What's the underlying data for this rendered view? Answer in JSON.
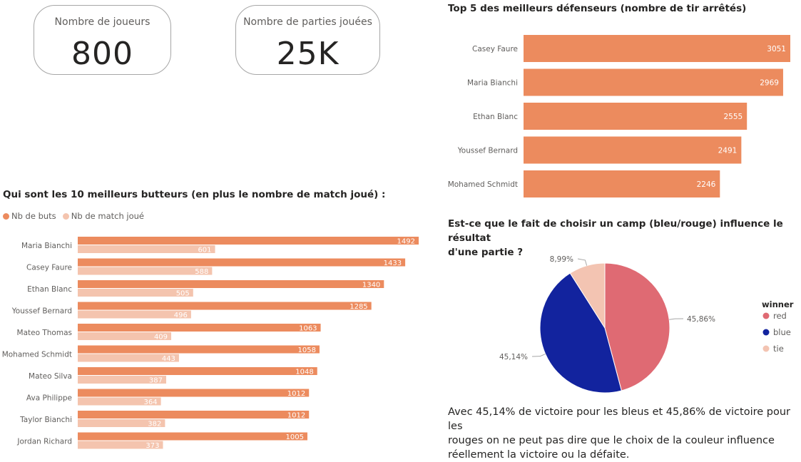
{
  "kpis": [
    {
      "label": "Nombre de joueurs",
      "value": "800"
    },
    {
      "label": "Nombre de parties jouées",
      "value": "25K"
    }
  ],
  "colors": {
    "orange": "#ec8b5e",
    "light_orange": "#f4c4ae",
    "red": "#df6a73",
    "blue": "#12239e",
    "tie": "#f3c4b2"
  },
  "top_defenders": {
    "title": "Top 5 des meilleurs défenseurs (nombre de tir arrêtés)"
  },
  "scorers": {
    "title": "Qui sont les 10 meilleurs butteurs (en plus le nombre de match joué) :",
    "legend": [
      "Nb de buts",
      "Nb de match joué"
    ]
  },
  "pie": {
    "title_line1": "Est-ce que le fait de choisir un camp (bleu/rouge) influence le résultat",
    "title_line2": "d'une partie ?",
    "legend_title": "winner"
  },
  "caption": {
    "line1": "Avec 45,14% de victoire pour les bleus  et 45,86% de victoire pour les",
    "line2": "rouges on ne peut pas dire que le choix de la couleur influence",
    "line3": "réellement la victoire ou la défaite."
  },
  "chart_data": [
    {
      "type": "bar",
      "orientation": "horizontal",
      "title": "Top 5 des meilleurs défenseurs (nombre de tir arrêtés)",
      "categories": [
        "Casey Faure",
        "Maria Bianchi",
        "Ethan Blanc",
        "Youssef Bernard",
        "Mohamed Schmidt"
      ],
      "values": [
        3051,
        2969,
        2555,
        2491,
        2246
      ],
      "xlim": [
        0,
        3051
      ],
      "grid": false,
      "data_labels": true
    },
    {
      "type": "bar",
      "orientation": "horizontal",
      "title": "Qui sont les 10 meilleurs butteurs (en plus le nombre de match joué) :",
      "categories": [
        "Maria Bianchi",
        "Casey Faure",
        "Ethan Blanc",
        "Youssef Bernard",
        "Mateo Thomas",
        "Mohamed Schmidt",
        "Mateo Silva",
        "Ava Philippe",
        "Taylor Bianchi",
        "Jordan Richard"
      ],
      "series": [
        {
          "name": "Nb de buts",
          "values": [
            1492,
            1433,
            1340,
            1285,
            1063,
            1058,
            1048,
            1012,
            1012,
            1005
          ]
        },
        {
          "name": "Nb de match joué",
          "values": [
            601,
            588,
            505,
            496,
            409,
            443,
            387,
            364,
            382,
            373
          ]
        }
      ],
      "xlim": [
        0,
        1492
      ],
      "legend": "top-left",
      "grid": false,
      "data_labels": true
    },
    {
      "type": "pie",
      "title": "Est-ce que le fait de choisir un camp (bleu/rouge) influence le résultat d'une partie ?",
      "legend_title": "winner",
      "legend": "right",
      "slices": [
        {
          "label": "red",
          "value": 45.86,
          "display": "45,86%"
        },
        {
          "label": "blue",
          "value": 45.14,
          "display": "45,14%"
        },
        {
          "label": "tie",
          "value": 8.99,
          "display": "8,99%"
        }
      ]
    }
  ]
}
